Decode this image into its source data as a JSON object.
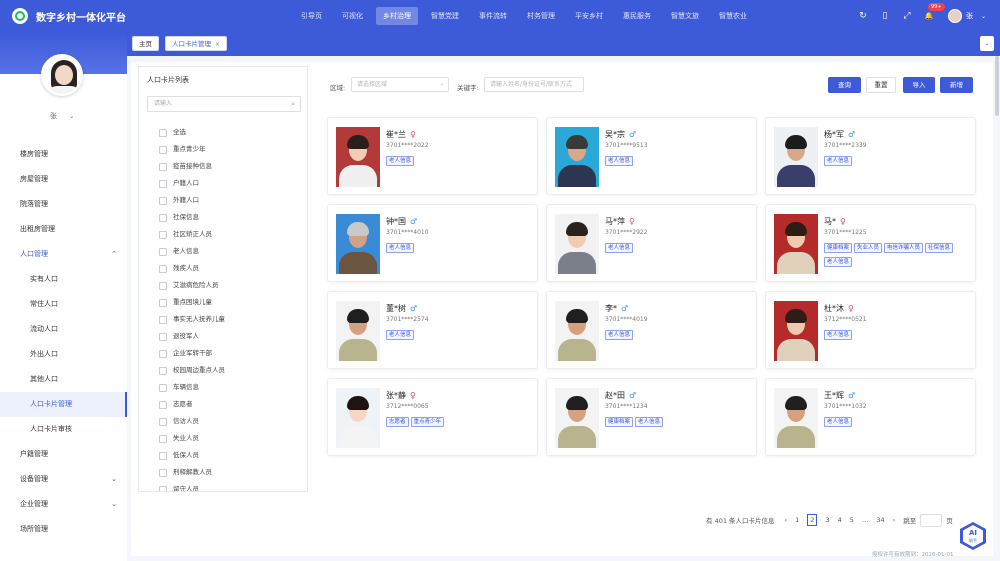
{
  "app": {
    "title": "数字乡村一体化平台"
  },
  "nav": [
    {
      "label": "引导页",
      "active": false
    },
    {
      "label": "可视化",
      "active": false
    },
    {
      "label": "乡村治理",
      "active": true
    },
    {
      "label": "智慧党建",
      "active": false
    },
    {
      "label": "事件流转",
      "active": false
    },
    {
      "label": "村务管理",
      "active": false
    },
    {
      "label": "平安乡村",
      "active": false
    },
    {
      "label": "惠民服务",
      "active": false
    },
    {
      "label": "智慧文旅",
      "active": false
    },
    {
      "label": "智慧农业",
      "active": false
    }
  ],
  "header": {
    "badge": "99+",
    "user": "张"
  },
  "sidebar": {
    "user_name": "张",
    "items": [
      {
        "label": "楼房管理",
        "level": 1,
        "state": ""
      },
      {
        "label": "房屋管理",
        "level": 1,
        "state": ""
      },
      {
        "label": "院落管理",
        "level": 1,
        "state": ""
      },
      {
        "label": "出租房管理",
        "level": 1,
        "state": ""
      },
      {
        "label": "人口管理",
        "level": 1,
        "state": "open",
        "chev": "⌃"
      },
      {
        "label": "实有人口",
        "level": 2,
        "state": ""
      },
      {
        "label": "常住人口",
        "level": 2,
        "state": ""
      },
      {
        "label": "流动人口",
        "level": 2,
        "state": ""
      },
      {
        "label": "外出人口",
        "level": 2,
        "state": ""
      },
      {
        "label": "其他人口",
        "level": 2,
        "state": ""
      },
      {
        "label": "人口卡片管理",
        "level": 2,
        "state": "active"
      },
      {
        "label": "人口卡片审核",
        "level": 2,
        "state": ""
      },
      {
        "label": "户籍管理",
        "level": 1,
        "state": ""
      },
      {
        "label": "设备管理",
        "level": 1,
        "state": "",
        "chev": "⌄"
      },
      {
        "label": "企业管理",
        "level": 1,
        "state": "",
        "chev": "⌄"
      },
      {
        "label": "场所管理",
        "level": 1,
        "state": ""
      }
    ]
  },
  "tabs": [
    {
      "label": "主页"
    },
    {
      "label": "人口卡片管理",
      "close": "×"
    }
  ],
  "category": {
    "title": "人口卡片列表",
    "search_placeholder": "请输入",
    "items": [
      "全选",
      "重点青少年",
      "疫苗接种信息",
      "户籍人口",
      "外籍人口",
      "社保信息",
      "社区矫正人员",
      "老人信息",
      "残疾人员",
      "艾滋病危险人员",
      "重点困境儿童",
      "事实无人抚养儿童",
      "退役军人",
      "企业军转干部",
      "校园周边重点人员",
      "车辆信息",
      "志愿者",
      "信访人员",
      "失业人员",
      "低保人员",
      "刑释解教人员",
      "留守人员"
    ]
  },
  "filters": {
    "area_label": "区域:",
    "area_placeholder": "请选择区域",
    "keyword_label": "关键字:",
    "keyword_placeholder": "请输入姓名/身份证号/联系方式",
    "query": "查询",
    "reset": "重置",
    "import": "导入",
    "add": "新增"
  },
  "cards": [
    {
      "name": "崔*兰",
      "sex": "f",
      "sex_symbol": "♀",
      "id": "3701****2022",
      "tags": [
        "老人信息"
      ],
      "skin": "#f1cdb6",
      "hair": "#2a1f1a",
      "body": "#f0f0f0",
      "bg": "#b33a3a"
    },
    {
      "name": "吴*宗",
      "sex": "m",
      "sex_symbol": "♂",
      "id": "3701****9513",
      "tags": [
        "老人信息"
      ],
      "skin": "#d9a88a",
      "hair": "#3a3a3a",
      "body": "#2d3550",
      "bg": "#2aa9d6"
    },
    {
      "name": "杨*军",
      "sex": "m",
      "sex_symbol": "♂",
      "id": "3701****2339",
      "tags": [
        "老人信息"
      ],
      "skin": "#d8a988",
      "hair": "#1c1c1c",
      "body": "#3b3e6a",
      "bg": "#eef1f4"
    },
    {
      "name": "钟*国",
      "sex": "m",
      "sex_symbol": "♂",
      "id": "3701****4010",
      "tags": [
        "老人信息"
      ],
      "skin": "#d4a084",
      "hair": "#c9c9c9",
      "body": "#6a5640",
      "bg": "#3a8bd6"
    },
    {
      "name": "马*萍",
      "sex": "f",
      "sex_symbol": "♀",
      "id": "3701****2922",
      "tags": [
        "老人信息"
      ],
      "skin": "#f0cbb2",
      "hair": "#2a2220",
      "body": "#7a7f8a",
      "bg": "#f2f2f2"
    },
    {
      "name": "马*",
      "sex": "f",
      "sex_symbol": "♀",
      "id": "3701****1225",
      "tags": [
        "健康档案",
        "失业人员",
        "电信诈骗人员",
        "社保信息",
        "老人信息"
      ],
      "skin": "#f1c9ae",
      "hair": "#2e1d14",
      "body": "#e0d1bc",
      "bg": "#b52a2a"
    },
    {
      "name": "董*树",
      "sex": "m",
      "sex_symbol": "♂",
      "id": "3701****2574",
      "tags": [
        "老人信息"
      ],
      "skin": "#d6a180",
      "hair": "#1f1f1f",
      "body": "#b7b48e",
      "bg": "#f3f3f3"
    },
    {
      "name": "李*",
      "sex": "m",
      "sex_symbol": "♂",
      "id": "3701****4019",
      "tags": [
        "老人信息"
      ],
      "skin": "#d6a180",
      "hair": "#1f1f1f",
      "body": "#b7b48e",
      "bg": "#f3f3f3"
    },
    {
      "name": "杜*沐",
      "sex": "f",
      "sex_symbol": "♀",
      "id": "3712****0521",
      "tags": [
        "老人信息"
      ],
      "skin": "#f1c9ae",
      "hair": "#2e1d14",
      "body": "#e0d1bc",
      "bg": "#b52a2a"
    },
    {
      "name": "张*静",
      "sex": "f",
      "sex_symbol": "♀",
      "id": "3712****0065",
      "tags": [
        "志愿者",
        "重点青少年"
      ],
      "skin": "#f5d6c4",
      "hair": "#1c1512",
      "body": "#f4f4f4",
      "bg": "#eef3f8"
    },
    {
      "name": "赵*田",
      "sex": "m",
      "sex_symbol": "♂",
      "id": "3701****1234",
      "tags": [
        "健康档案",
        "老人信息"
      ],
      "skin": "#d6a180",
      "hair": "#1f1f1f",
      "body": "#b7b48e",
      "bg": "#f3f3f3"
    },
    {
      "name": "王*辉",
      "sex": "m",
      "sex_symbol": "♂",
      "id": "3701****1032",
      "tags": [
        "老人信息"
      ],
      "skin": "#d6a180",
      "hair": "#1f1f1f",
      "body": "#b7b48e",
      "bg": "#f3f3f3"
    }
  ],
  "pagination": {
    "total_text": "有 401 条人口卡片信息",
    "prev": "‹",
    "pages": [
      "1",
      "2",
      "3",
      "4",
      "5",
      "…",
      "34"
    ],
    "current": "2",
    "next": "›",
    "jump_label": "跳至",
    "page_unit": "页"
  },
  "footer": {
    "note": "授权许可有效期到：2026-01-01"
  },
  "ai": {
    "label": "AI",
    "sub": "助手"
  },
  "icons": {
    "refresh": "↻",
    "phone": "▯",
    "fullscreen": "⤢",
    "bell": "🔔",
    "caret": "⌄",
    "search": "⌕"
  },
  "colors": {
    "primary": "#3d5bd9",
    "female": "#e0436b",
    "male": "#3d8ef0"
  }
}
